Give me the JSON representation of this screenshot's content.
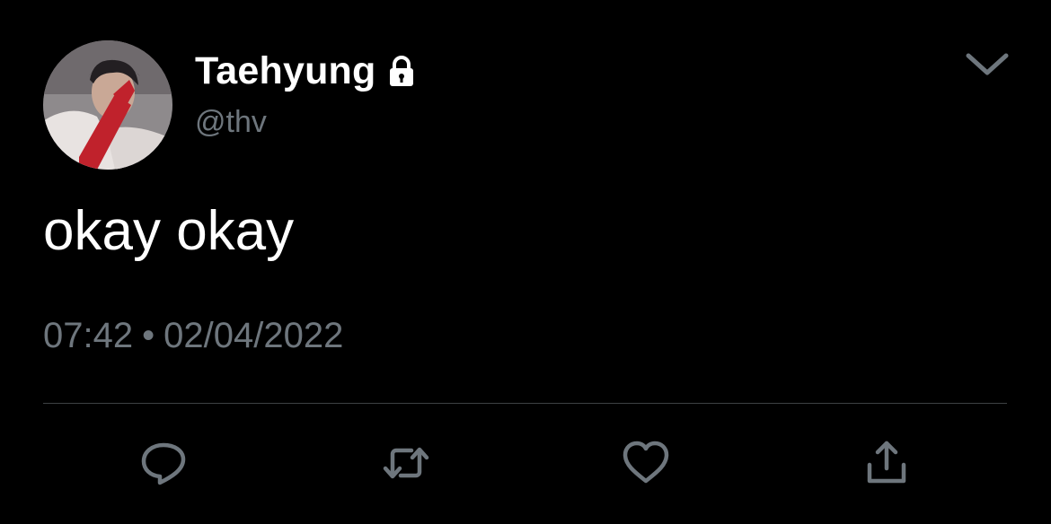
{
  "author": {
    "display_name": "Taehyung",
    "handle": "@thv",
    "protected": true,
    "avatar_icon": "profile-photo"
  },
  "tweet": {
    "text": "okay okay",
    "time": "07:42",
    "separator": "•",
    "date": "02/04/2022"
  },
  "actions": [
    {
      "name": "reply",
      "icon": "reply-icon"
    },
    {
      "name": "retweet",
      "icon": "retweet-icon"
    },
    {
      "name": "like",
      "icon": "heart-icon"
    },
    {
      "name": "share",
      "icon": "share-icon"
    }
  ],
  "colors": {
    "background": "#000000",
    "primary_text": "#ffffff",
    "secondary_text": "#6e767d",
    "divider": "#3d4144"
  }
}
